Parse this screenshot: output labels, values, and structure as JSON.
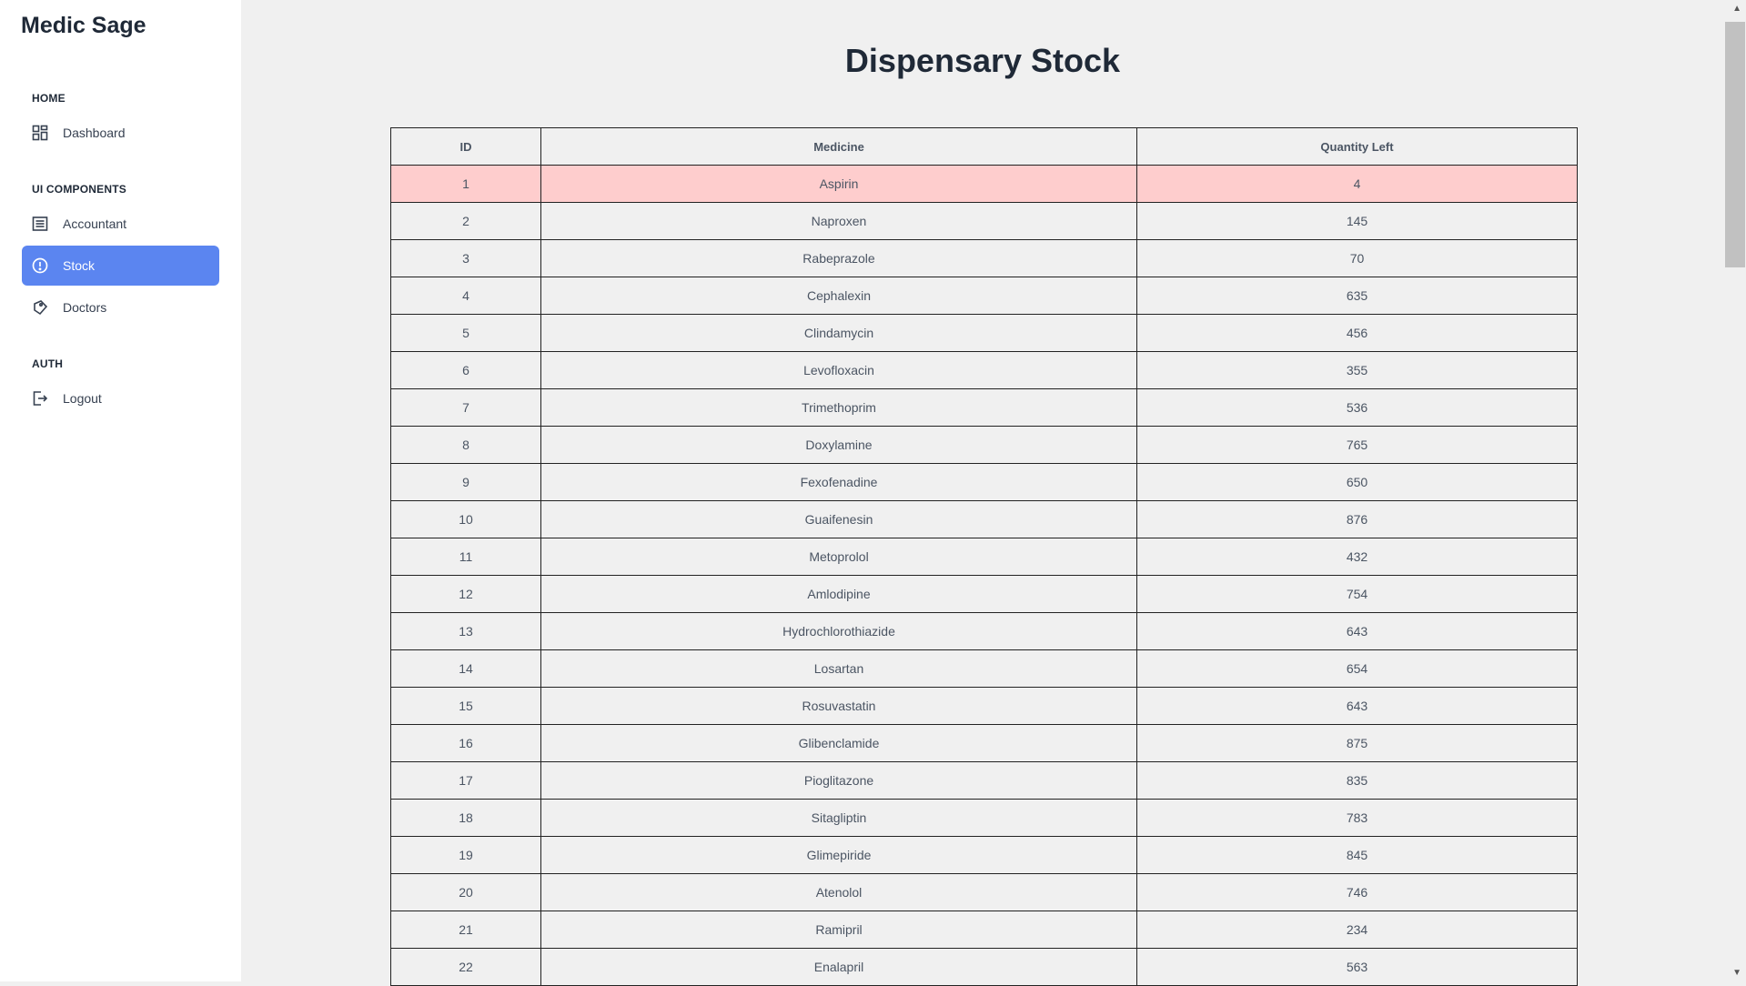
{
  "app": {
    "title": "Medic Sage"
  },
  "sidebar": {
    "sections": [
      {
        "title": "HOME"
      },
      {
        "title": "UI COMPONENTS"
      },
      {
        "title": "AUTH"
      }
    ],
    "items": [
      {
        "label": "Dashboard",
        "icon": "dashboard-icon"
      },
      {
        "label": "Accountant",
        "icon": "list-icon"
      },
      {
        "label": "Stock",
        "icon": "alert-circle-icon",
        "active": true
      },
      {
        "label": "Doctors",
        "icon": "tag-icon"
      },
      {
        "label": "Logout",
        "icon": "logout-icon"
      }
    ]
  },
  "main": {
    "title": "Dispensary Stock",
    "table": {
      "headers": [
        "ID",
        "Medicine",
        "Quantity Left"
      ],
      "rows": [
        [
          "1",
          "Aspirin",
          "4"
        ],
        [
          "2",
          "Naproxen",
          "145"
        ],
        [
          "3",
          "Rabeprazole",
          "70"
        ],
        [
          "4",
          "Cephalexin",
          "635"
        ],
        [
          "5",
          "Clindamycin",
          "456"
        ],
        [
          "6",
          "Levofloxacin",
          "355"
        ],
        [
          "7",
          "Trimethoprim",
          "536"
        ],
        [
          "8",
          "Doxylamine",
          "765"
        ],
        [
          "9",
          "Fexofenadine",
          "650"
        ],
        [
          "10",
          "Guaifenesin",
          "876"
        ],
        [
          "11",
          "Metoprolol",
          "432"
        ],
        [
          "12",
          "Amlodipine",
          "754"
        ],
        [
          "13",
          "Hydrochlorothiazide",
          "643"
        ],
        [
          "14",
          "Losartan",
          "654"
        ],
        [
          "15",
          "Rosuvastatin",
          "643"
        ],
        [
          "16",
          "Glibenclamide",
          "875"
        ],
        [
          "17",
          "Pioglitazone",
          "835"
        ],
        [
          "18",
          "Sitagliptin",
          "783"
        ],
        [
          "19",
          "Glimepiride",
          "845"
        ],
        [
          "20",
          "Atenolol",
          "746"
        ],
        [
          "21",
          "Ramipril",
          "234"
        ],
        [
          "22",
          "Enalapril",
          "563"
        ]
      ]
    }
  },
  "colors": {
    "accent": "#5b85f0",
    "low_stock_row": "#fecdcd",
    "background": "#f0f0f0"
  }
}
